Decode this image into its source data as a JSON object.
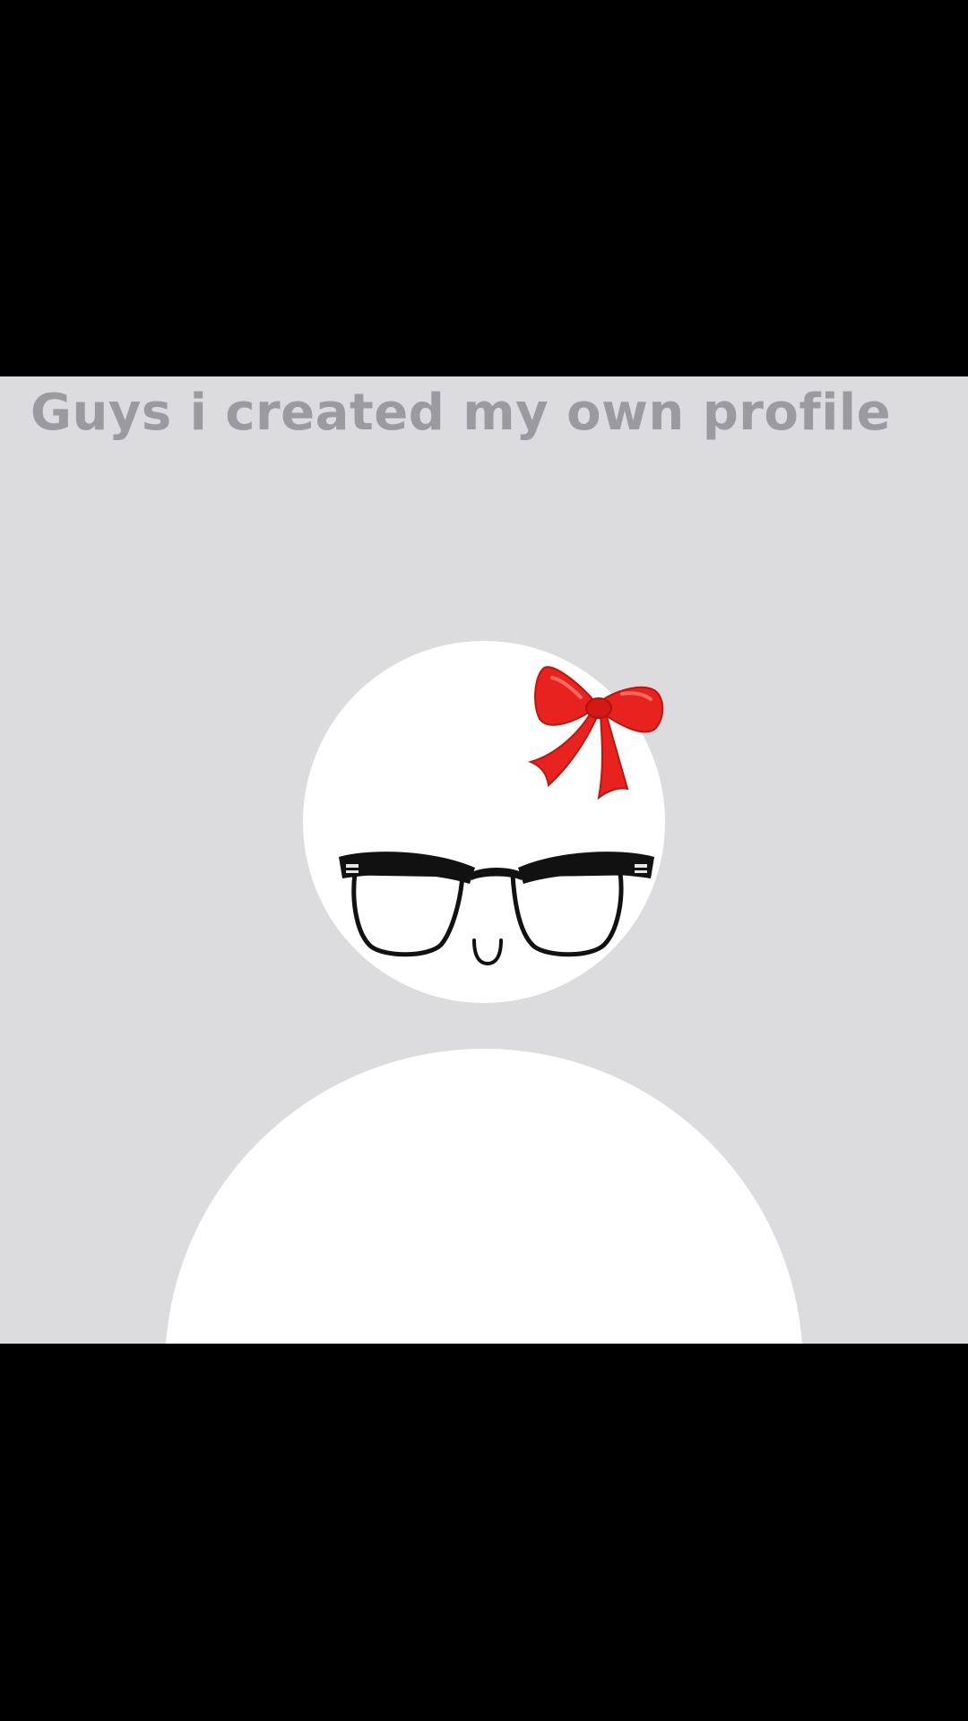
{
  "caption": "Guys i created my own profile",
  "colors": {
    "background": "#dcdcde",
    "letterbox": "#000000",
    "caption_text": "#9b9b9f",
    "avatar": "#ffffff",
    "bow": "#e8231f",
    "glasses_frame": "#111111"
  },
  "avatar": {
    "accessories": [
      "bow-icon",
      "glasses-icon",
      "smile-icon"
    ]
  }
}
